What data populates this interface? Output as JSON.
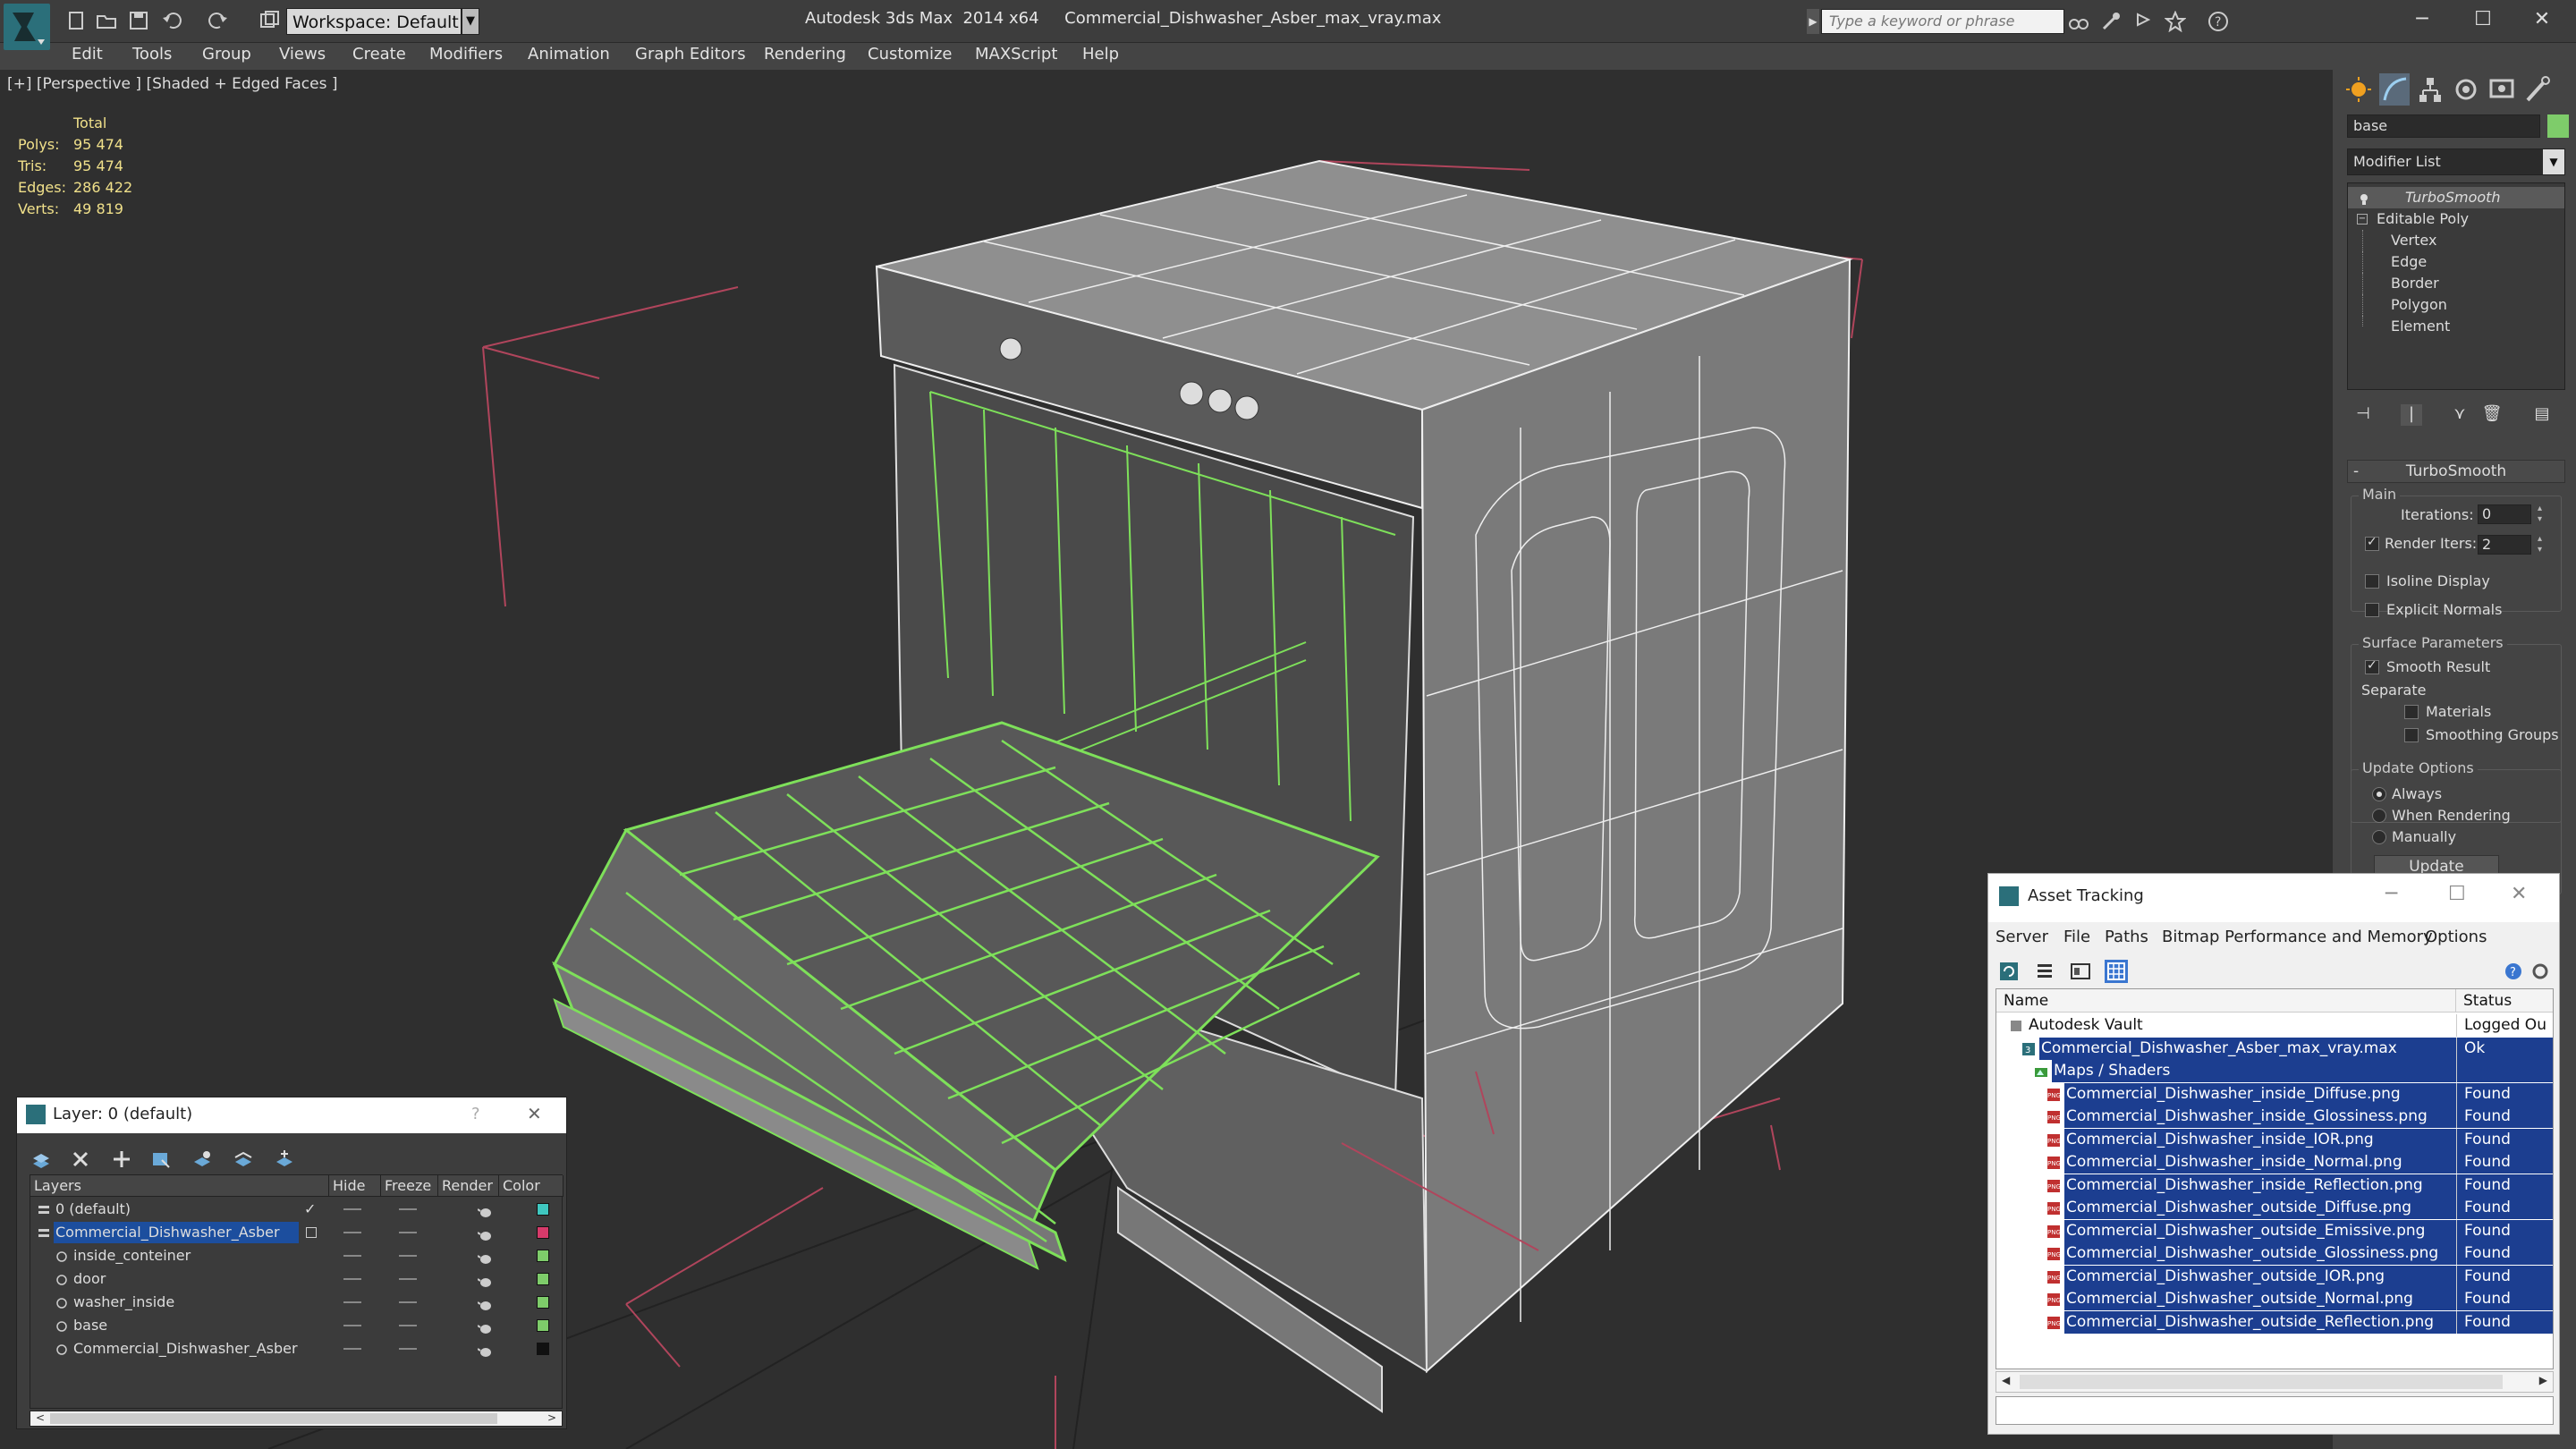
{
  "app": {
    "title": "Autodesk 3ds Max  2014 x64     Commercial_Dishwasher_Asber_max_vray.max",
    "workspace_label": "Workspace: Default",
    "search_placeholder": "Type a keyword or phrase",
    "window_controls": [
      "minimize-icon",
      "maximize-icon",
      "close-icon"
    ]
  },
  "menubar": [
    "Edit",
    "Tools",
    "Group",
    "Views",
    "Create",
    "Modifiers",
    "Animation",
    "Graph Editors",
    "Rendering",
    "Customize",
    "MAXScript",
    "Help"
  ],
  "viewport": {
    "label": "[+] [Perspective ] [Shaded + Edged Faces ]",
    "stats": {
      "header": "Total",
      "rows": [
        {
          "k": "Polys:",
          "v": "95 474"
        },
        {
          "k": "Tris:",
          "v": "95 474"
        },
        {
          "k": "Edges:",
          "v": "286 422"
        },
        {
          "k": "Verts:",
          "v": "49 819"
        }
      ]
    }
  },
  "command_panel": {
    "object_name": "base",
    "object_color": "#7ecc6a",
    "modifier_list_label": "Modifier List",
    "stack": [
      {
        "label": "TurboSmooth",
        "level": 0,
        "italic": true
      },
      {
        "label": "Editable Poly",
        "level": 0,
        "italic": false
      },
      {
        "label": "Vertex",
        "level": 1
      },
      {
        "label": "Edge",
        "level": 1
      },
      {
        "label": "Border",
        "level": 1
      },
      {
        "label": "Polygon",
        "level": 1
      },
      {
        "label": "Element",
        "level": 1
      }
    ],
    "turbosmooth": {
      "title": "TurboSmooth",
      "main_label": "Main",
      "iterations_label": "Iterations:",
      "iterations_value": "0",
      "render_iters_label": "Render Iters:",
      "render_iters_value": "2",
      "isoline_label": "Isoline Display",
      "explicit_label": "Explicit Normals",
      "surface_label": "Surface Parameters",
      "smooth_result_label": "Smooth Result",
      "separate_label": "Separate",
      "materials_label": "Materials",
      "smoothing_groups_label": "Smoothing Groups",
      "update_options_label": "Update Options",
      "always_label": "Always",
      "when_rendering_label": "When Rendering",
      "manually_label": "Manually",
      "update_button": "Update"
    }
  },
  "asset_tracking": {
    "title": "Asset Tracking",
    "menu": [
      "Server",
      "File",
      "Paths",
      "Bitmap Performance and Memory",
      "Options"
    ],
    "columns": [
      "Name",
      "Status"
    ],
    "rows": [
      {
        "name": "Autodesk Vault",
        "status": "Logged Ou",
        "indent": 1,
        "icon": "vault"
      },
      {
        "name": "Commercial_Dishwasher_Asber_max_vray.max",
        "status": "Ok",
        "indent": 2,
        "icon": "max"
      },
      {
        "name": "Maps / Shaders",
        "status": "",
        "indent": 3,
        "icon": "maps"
      },
      {
        "name": "Commercial_Dishwasher_inside_Diffuse.png",
        "status": "Found",
        "indent": 4,
        "icon": "png"
      },
      {
        "name": "Commercial_Dishwasher_inside_Glossiness.png",
        "status": "Found",
        "indent": 4,
        "icon": "png"
      },
      {
        "name": "Commercial_Dishwasher_inside_IOR.png",
        "status": "Found",
        "indent": 4,
        "icon": "png"
      },
      {
        "name": "Commercial_Dishwasher_inside_Normal.png",
        "status": "Found",
        "indent": 4,
        "icon": "png"
      },
      {
        "name": "Commercial_Dishwasher_inside_Reflection.png",
        "status": "Found",
        "indent": 4,
        "icon": "png"
      },
      {
        "name": "Commercial_Dishwasher_outside_Diffuse.png",
        "status": "Found",
        "indent": 4,
        "icon": "png"
      },
      {
        "name": "Commercial_Dishwasher_outside_Emissive.png",
        "status": "Found",
        "indent": 4,
        "icon": "png"
      },
      {
        "name": "Commercial_Dishwasher_outside_Glossiness.png",
        "status": "Found",
        "indent": 4,
        "icon": "png"
      },
      {
        "name": "Commercial_Dishwasher_outside_IOR.png",
        "status": "Found",
        "indent": 4,
        "icon": "png"
      },
      {
        "name": "Commercial_Dishwasher_outside_Normal.png",
        "status": "Found",
        "indent": 4,
        "icon": "png"
      },
      {
        "name": "Commercial_Dishwasher_outside_Reflection.png",
        "status": "Found",
        "indent": 4,
        "icon": "png"
      }
    ]
  },
  "layer_manager": {
    "title": "Layer: 0 (default)",
    "help": "?",
    "columns": [
      "Layers",
      "Hide",
      "Freeze",
      "Render",
      "Color"
    ],
    "rows": [
      {
        "name": "0 (default)",
        "indent": 0,
        "color": "#3fc7c0",
        "selected": false,
        "current": true
      },
      {
        "name": "Commercial_Dishwasher_Asber",
        "indent": 0,
        "color": "#d63a6a",
        "selected": true,
        "current": false
      },
      {
        "name": "inside_conteiner",
        "indent": 1,
        "color": "#7ecc6a",
        "selected": false,
        "current": false
      },
      {
        "name": "door",
        "indent": 1,
        "color": "#7ecc6a",
        "selected": false,
        "current": false
      },
      {
        "name": "washer_inside",
        "indent": 1,
        "color": "#7ecc6a",
        "selected": false,
        "current": false
      },
      {
        "name": "base",
        "indent": 1,
        "color": "#7ecc6a",
        "selected": false,
        "current": false
      },
      {
        "name": "Commercial_Dishwasher_Asber",
        "indent": 1,
        "color": "#111111",
        "selected": false,
        "current": false
      }
    ]
  }
}
